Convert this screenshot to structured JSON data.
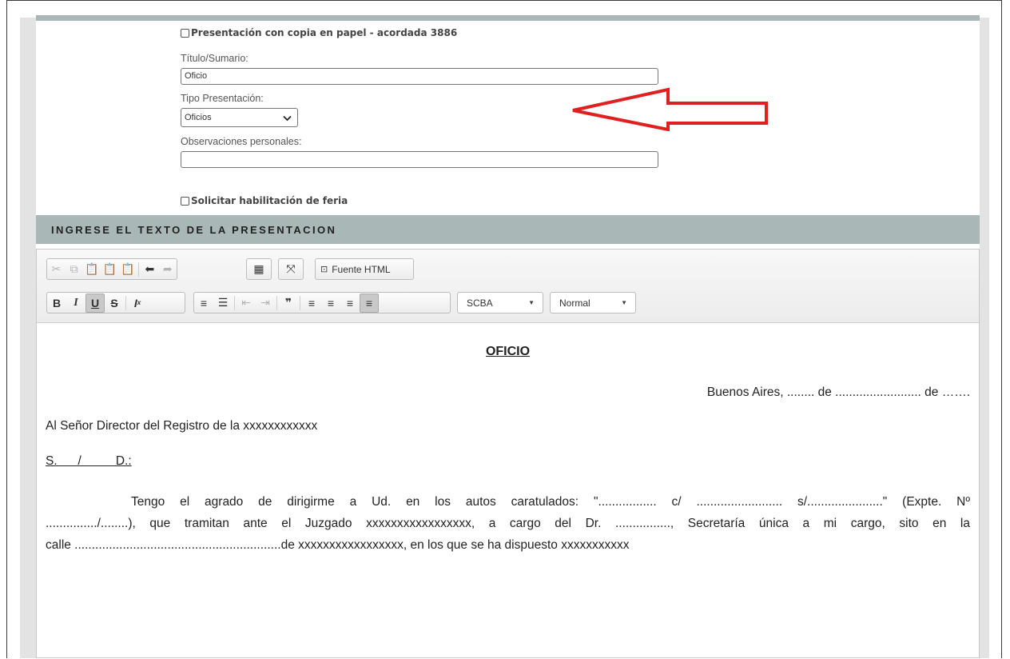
{
  "form": {
    "checkbox_paper_copy": "Presentación con copia en papel - acordada 3886",
    "title_label": "Título/Sumario:",
    "title_value": "Oficio",
    "type_label": "Tipo Presentación:",
    "type_value": "Oficios",
    "observations_label": "Observaciones personales:",
    "observations_value": "",
    "checkbox_feria": "Solicitar habilitación de feria"
  },
  "section": {
    "title": "INGRESE EL TEXTO DE LA PRESENTACION"
  },
  "toolbar": {
    "source_label": "Fuente HTML",
    "font_value": "SCBA",
    "format_value": "Normal"
  },
  "document": {
    "heading": "OFICIO ",
    "date_line": "Buenos Aires, ........ de ......................... de …….",
    "addressee": "Al Señor Director del Registro de la xxxxxxxxxxxx",
    "salutation": "S.      /          D.:",
    "body_line1": "Tengo el agrado de dirigirme a Ud. en los autos caratulados: \"................. c/ ......................... s/......................\" (Expte. Nº",
    "body_line2": ".............../........), que tramitan ante el Juzgado xxxxxxxxxxxxxxxxx, a cargo del Dr. ................, Secretaría única a mi cargo, sito en la",
    "body_line3": "calle ............................................................de xxxxxxxxxxxxxxxxx, en los que se ha dispuesto xxxxxxxxxxx"
  },
  "colors": {
    "section_bar": "#a9b8b6",
    "annotation_arrow": "#e02020"
  }
}
